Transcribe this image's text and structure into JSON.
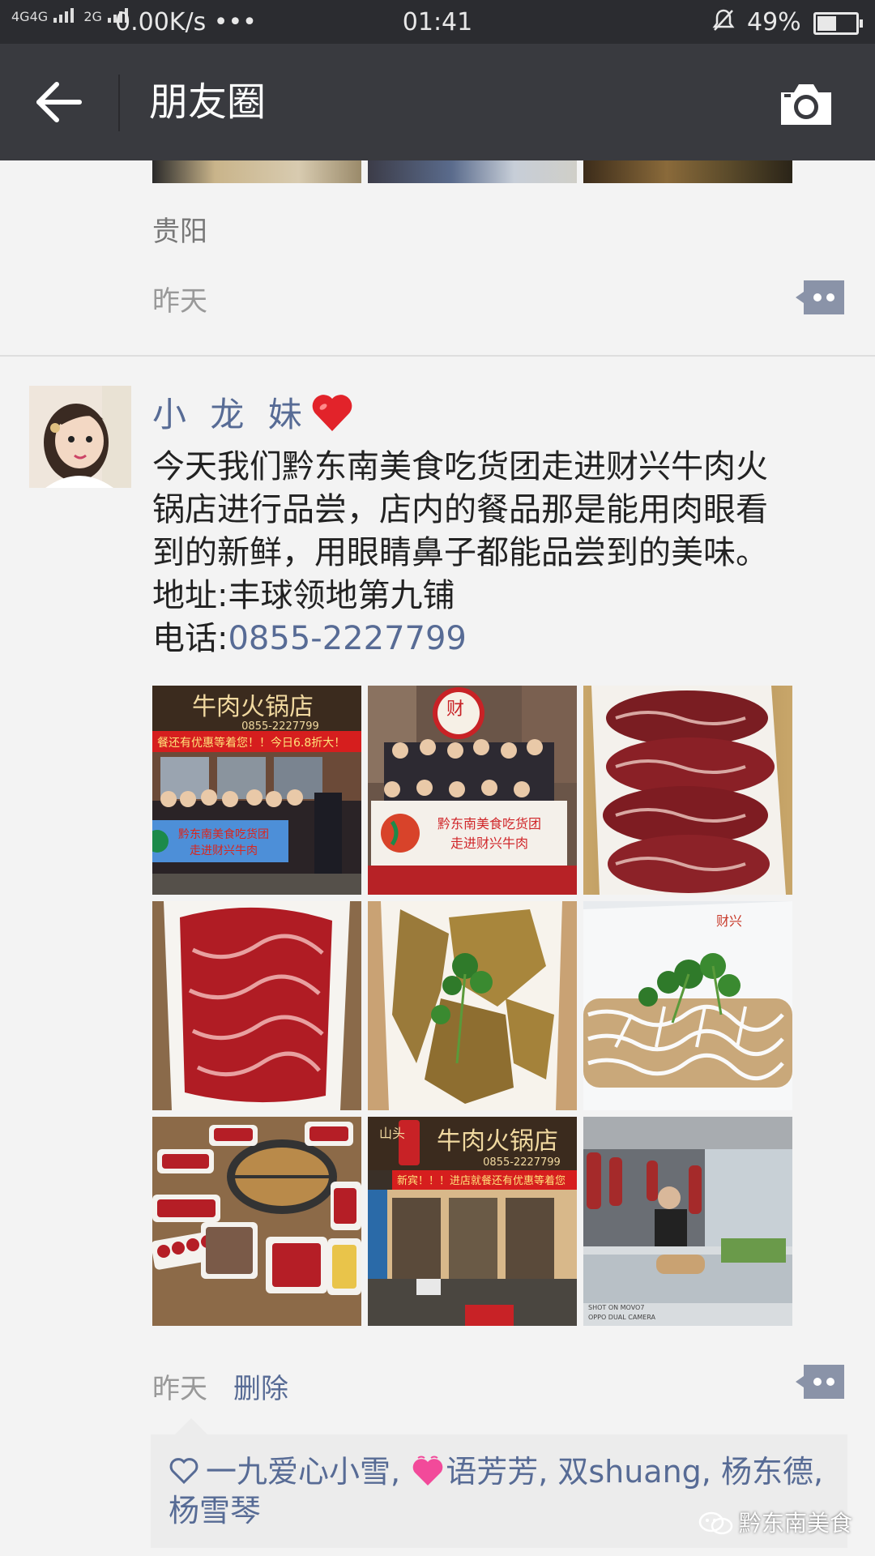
{
  "status_bar": {
    "network_1": "4G",
    "network_2": "4G",
    "network_3": "2G",
    "speed": "0.00K/s",
    "dots": "•••",
    "time": "01:41",
    "battery": "49%",
    "battery_level": 0.49
  },
  "nav": {
    "title": "朋友圈",
    "back_icon": "arrow-left-icon",
    "camera_icon": "camera-icon"
  },
  "previous_post": {
    "location": "贵阳",
    "time": "昨天"
  },
  "post": {
    "author": "小 龙 妹",
    "author_emoji": "red-heart",
    "text_line_1": "今天我们黔东南美食吃货团走进财兴牛肉火",
    "text_line_2": "锅店进行品尝，店内的餐品那是能用肉眼看",
    "text_line_3": "到的新鲜，用眼睛鼻子都能品尝到的美味。",
    "address": "地址:丰球领地第九铺",
    "phone_label": "电话:",
    "phone": "0855-2227799",
    "images": [
      {
        "desc": "restaurant-storefront-group-photo",
        "sign": "牛肉火锅店",
        "phone": "0855-2227799",
        "banner": "餐还有优惠等着您！！今日6.8折大！",
        "held_banner_1": "黔东南美食吃货团",
        "held_banner_2": "走进财兴牛肉"
      },
      {
        "desc": "group-photo-indoors",
        "logo": "财",
        "held_banner_1": "黔东南美食吃货团",
        "held_banner_2": "走进财兴牛肉"
      },
      {
        "desc": "sliced-beef-plate"
      },
      {
        "desc": "raw-beef-on-plate"
      },
      {
        "desc": "beef-tripe-with-cilantro"
      },
      {
        "desc": "fried-dish-with-mayo",
        "plate_text": "财兴"
      },
      {
        "desc": "hotpot-table-spread"
      },
      {
        "desc": "restaurant-entrance-night",
        "sign_left": "山头",
        "sign": "牛肉火锅店",
        "phone": "0855-2227799",
        "banner": "新宾！！！进店就餐还有优惠等着您"
      },
      {
        "desc": "butcher-counter",
        "caption_1": "SHOT ON MOVO7",
        "caption_2": "OPPO DUAL CAMERA"
      }
    ],
    "time": "昨天",
    "delete_label": "删除"
  },
  "likes": {
    "text_1": "一九爱心小雪,",
    "text_2": "语芳芳, 双shuang, 杨东德, 杨雪琴"
  },
  "watermark": "黔东南美食",
  "colors": {
    "link": "#576b95",
    "nav_bg": "#393a3f",
    "status_bg": "#2b2c30",
    "page_bg": "#f3f3f3"
  }
}
